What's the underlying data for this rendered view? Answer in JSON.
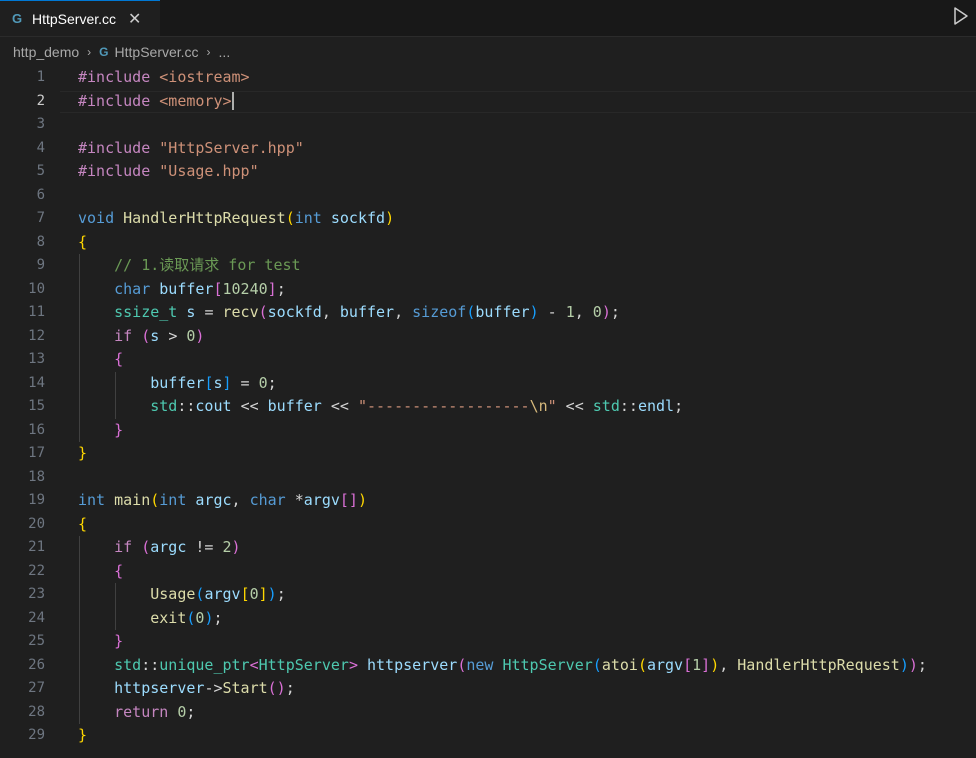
{
  "tab": {
    "title": "HttpServer.cc",
    "file_icon": "G",
    "close_glyph": "✕"
  },
  "breadcrumb": {
    "folder": "http_demo",
    "separator": "›",
    "file": "HttpServer.cc",
    "file_icon": "G",
    "separator2": "›",
    "more": "..."
  },
  "editor": {
    "line_numbers": [
      "1",
      "2",
      "3",
      "4",
      "5",
      "6",
      "7",
      "8",
      "9",
      "10",
      "11",
      "12",
      "13",
      "14",
      "15",
      "16",
      "17",
      "18",
      "19",
      "20",
      "21",
      "22",
      "23",
      "24",
      "25",
      "26",
      "27",
      "28",
      "29"
    ],
    "active_line": 2,
    "lines": [
      [
        [
          "#include ",
          "k-pre"
        ],
        [
          "<iostream>",
          "k-inc"
        ]
      ],
      [
        [
          "#include ",
          "k-pre"
        ],
        [
          "<memory>",
          "k-inc"
        ]
      ],
      [],
      [
        [
          "#include ",
          "k-pre"
        ],
        [
          "\"HttpServer.hpp\"",
          "k-str"
        ]
      ],
      [
        [
          "#include ",
          "k-pre"
        ],
        [
          "\"Usage.hpp\"",
          "k-str"
        ]
      ],
      [],
      [
        [
          "void ",
          "k-type"
        ],
        [
          "HandlerHttpRequest",
          "k-fn"
        ],
        [
          "(",
          "b1"
        ],
        [
          "int ",
          "k-type"
        ],
        [
          "sockfd",
          "k-var"
        ],
        [
          ")",
          "b1"
        ]
      ],
      [
        [
          "{",
          "b1"
        ]
      ],
      [
        [
          "    ",
          ""
        ],
        [
          "// 1.读取请求 for test",
          "k-cmt"
        ]
      ],
      [
        [
          "    ",
          ""
        ],
        [
          "char ",
          "k-type"
        ],
        [
          "buffer",
          "k-var"
        ],
        [
          "[",
          "b2"
        ],
        [
          "10240",
          "k-num"
        ],
        [
          "]",
          "b2"
        ],
        [
          ";",
          "k-op"
        ]
      ],
      [
        [
          "    ",
          ""
        ],
        [
          "ssize_t ",
          "k-ns"
        ],
        [
          "s ",
          "k-var"
        ],
        [
          "= ",
          "k-op"
        ],
        [
          "recv",
          "k-fn"
        ],
        [
          "(",
          "b2"
        ],
        [
          "sockfd",
          "k-var"
        ],
        [
          ", ",
          "k-op"
        ],
        [
          "buffer",
          "k-var"
        ],
        [
          ", ",
          "k-op"
        ],
        [
          "sizeof",
          "k-type"
        ],
        [
          "(",
          "b3"
        ],
        [
          "buffer",
          "k-var"
        ],
        [
          ")",
          "b3"
        ],
        [
          " - ",
          "k-op"
        ],
        [
          "1",
          "k-num"
        ],
        [
          ", ",
          "k-op"
        ],
        [
          "0",
          "k-num"
        ],
        [
          ")",
          "b2"
        ],
        [
          ";",
          "k-op"
        ]
      ],
      [
        [
          "    ",
          ""
        ],
        [
          "if ",
          "k-ctl"
        ],
        [
          "(",
          "b2"
        ],
        [
          "s ",
          "k-var"
        ],
        [
          "> ",
          "k-op"
        ],
        [
          "0",
          "k-num"
        ],
        [
          ")",
          "b2"
        ]
      ],
      [
        [
          "    ",
          ""
        ],
        [
          "{",
          "b2"
        ]
      ],
      [
        [
          "        ",
          ""
        ],
        [
          "buffer",
          "k-var"
        ],
        [
          "[",
          "b3"
        ],
        [
          "s",
          "k-var"
        ],
        [
          "]",
          "b3"
        ],
        [
          " = ",
          "k-op"
        ],
        [
          "0",
          "k-num"
        ],
        [
          ";",
          "k-op"
        ]
      ],
      [
        [
          "        ",
          ""
        ],
        [
          "std",
          "k-ns"
        ],
        [
          "::",
          "k-op"
        ],
        [
          "cout ",
          "k-var"
        ],
        [
          "<< ",
          "k-op"
        ],
        [
          "buffer ",
          "k-var"
        ],
        [
          "<< ",
          "k-op"
        ],
        [
          "\"------------------",
          "k-str"
        ],
        [
          "\\n",
          "k-esc"
        ],
        [
          "\"",
          "k-str"
        ],
        [
          " << ",
          "k-op"
        ],
        [
          "std",
          "k-ns"
        ],
        [
          "::",
          "k-op"
        ],
        [
          "endl",
          "k-var"
        ],
        [
          ";",
          "k-op"
        ]
      ],
      [
        [
          "    ",
          ""
        ],
        [
          "}",
          "b2"
        ]
      ],
      [
        [
          "}",
          "b1"
        ]
      ],
      [],
      [
        [
          "int ",
          "k-type"
        ],
        [
          "main",
          "k-fn"
        ],
        [
          "(",
          "b1"
        ],
        [
          "int ",
          "k-type"
        ],
        [
          "argc",
          "k-var"
        ],
        [
          ", ",
          "k-op"
        ],
        [
          "char ",
          "k-type"
        ],
        [
          "*",
          "k-op"
        ],
        [
          "argv",
          "k-var"
        ],
        [
          "[]",
          "b2"
        ],
        [
          ")",
          "b1"
        ]
      ],
      [
        [
          "{",
          "b1"
        ]
      ],
      [
        [
          "    ",
          ""
        ],
        [
          "if ",
          "k-ctl"
        ],
        [
          "(",
          "b2"
        ],
        [
          "argc ",
          "k-var"
        ],
        [
          "!= ",
          "k-op"
        ],
        [
          "2",
          "k-num"
        ],
        [
          ")",
          "b2"
        ]
      ],
      [
        [
          "    ",
          ""
        ],
        [
          "{",
          "b2"
        ]
      ],
      [
        [
          "        ",
          ""
        ],
        [
          "Usage",
          "k-fn"
        ],
        [
          "(",
          "b3"
        ],
        [
          "argv",
          "k-var"
        ],
        [
          "[",
          "b1"
        ],
        [
          "0",
          "k-num"
        ],
        [
          "]",
          "b1"
        ],
        [
          ")",
          "b3"
        ],
        [
          ";",
          "k-op"
        ]
      ],
      [
        [
          "        ",
          ""
        ],
        [
          "exit",
          "k-fn"
        ],
        [
          "(",
          "b3"
        ],
        [
          "0",
          "k-num"
        ],
        [
          ")",
          "b3"
        ],
        [
          ";",
          "k-op"
        ]
      ],
      [
        [
          "    ",
          ""
        ],
        [
          "}",
          "b2"
        ]
      ],
      [
        [
          "    ",
          ""
        ],
        [
          "std",
          "k-ns"
        ],
        [
          "::",
          "k-op"
        ],
        [
          "unique_ptr",
          "k-ns"
        ],
        [
          "<",
          "b2"
        ],
        [
          "HttpServer",
          "k-ns"
        ],
        [
          ">",
          "b2"
        ],
        [
          " ",
          "k-op"
        ],
        [
          "httpserver",
          "k-var"
        ],
        [
          "(",
          "b2"
        ],
        [
          "new ",
          "k-type"
        ],
        [
          "HttpServer",
          "k-ns"
        ],
        [
          "(",
          "b3"
        ],
        [
          "atoi",
          "k-fn"
        ],
        [
          "(",
          "b1"
        ],
        [
          "argv",
          "k-var"
        ],
        [
          "[",
          "b2"
        ],
        [
          "1",
          "k-num"
        ],
        [
          "]",
          "b2"
        ],
        [
          ")",
          "b1"
        ],
        [
          ", ",
          "k-op"
        ],
        [
          "HandlerHttpRequest",
          "k-fn"
        ],
        [
          ")",
          "b3"
        ],
        [
          ")",
          "b2"
        ],
        [
          ";",
          "k-op"
        ]
      ],
      [
        [
          "    ",
          ""
        ],
        [
          "httpserver",
          "k-var"
        ],
        [
          "->",
          "k-op"
        ],
        [
          "Start",
          "k-fn"
        ],
        [
          "()",
          "b2"
        ],
        [
          ";",
          "k-op"
        ]
      ],
      [
        [
          "    ",
          ""
        ],
        [
          "return ",
          "k-ctl"
        ],
        [
          "0",
          "k-num"
        ],
        [
          ";",
          "k-op"
        ]
      ],
      [
        [
          "}",
          "b1"
        ]
      ]
    ]
  }
}
